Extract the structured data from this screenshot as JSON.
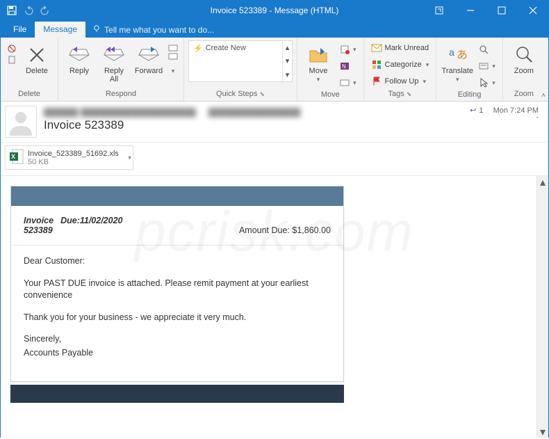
{
  "titlebar": {
    "title": "Invoice 523389 - Message (HTML)"
  },
  "tabs": {
    "file": "File",
    "message": "Message",
    "tellme": "Tell me what you want to do..."
  },
  "ribbon": {
    "delete": {
      "btn": "Delete",
      "group": "Delete"
    },
    "respond": {
      "reply": "Reply",
      "replyall_l1": "Reply",
      "replyall_l2": "All",
      "forward": "Forward",
      "group": "Respond"
    },
    "quicksteps": {
      "create": "Create New",
      "group": "Quick Steps"
    },
    "move": {
      "btn": "Move",
      "group": "Move"
    },
    "tags": {
      "unread": "Mark Unread",
      "categorize": "Categorize",
      "followup": "Follow Up",
      "group": "Tags"
    },
    "editing": {
      "translate": "Translate",
      "group": "Editing"
    },
    "zoom": {
      "btn": "Zoom",
      "group": "Zoom"
    }
  },
  "header": {
    "subject": "Invoice 523389",
    "reply_count": "1",
    "time": "Mon 7:24 PM"
  },
  "attachment": {
    "name": "Invoice_523389_51692.xls",
    "size": "50 KB"
  },
  "invoice": {
    "label": "Invoice",
    "number": "523389",
    "due": "Due:11/02/2020",
    "amount": "Amount Due: $1,860.00",
    "greeting": "Dear Customer:",
    "body1": "Your PAST DUE invoice is attached. Please remit payment at your earliest convenience",
    "body2": "Thank you for your business - we appreciate it very much.",
    "sign1": "Sincerely,",
    "sign2": "Accounts Payable"
  }
}
